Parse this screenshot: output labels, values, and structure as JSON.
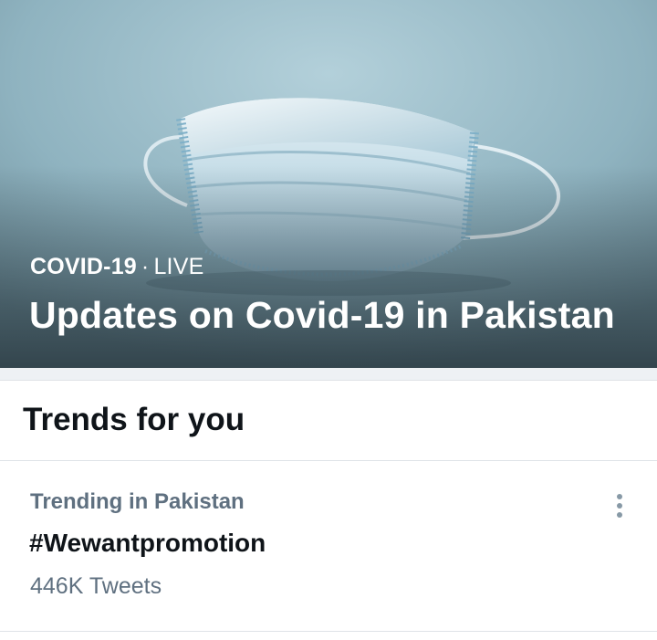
{
  "hero": {
    "topic": "COVID-19",
    "separator": "·",
    "status": "LIVE",
    "title": "Updates on Covid-19 in Pakistan",
    "image": "surgical-face-mask-photo"
  },
  "trends": {
    "heading": "Trends for you",
    "items": [
      {
        "context": "Trending in Pakistan",
        "name": "#Wewantpromotion",
        "count": "446K Tweets",
        "menu_icon": "more-vertical-icon"
      }
    ]
  },
  "colors": {
    "primary_text": "#0f1419",
    "secondary_text": "#5f7080",
    "divider": "#dfe3e7",
    "gap_background": "#eef1f4"
  }
}
